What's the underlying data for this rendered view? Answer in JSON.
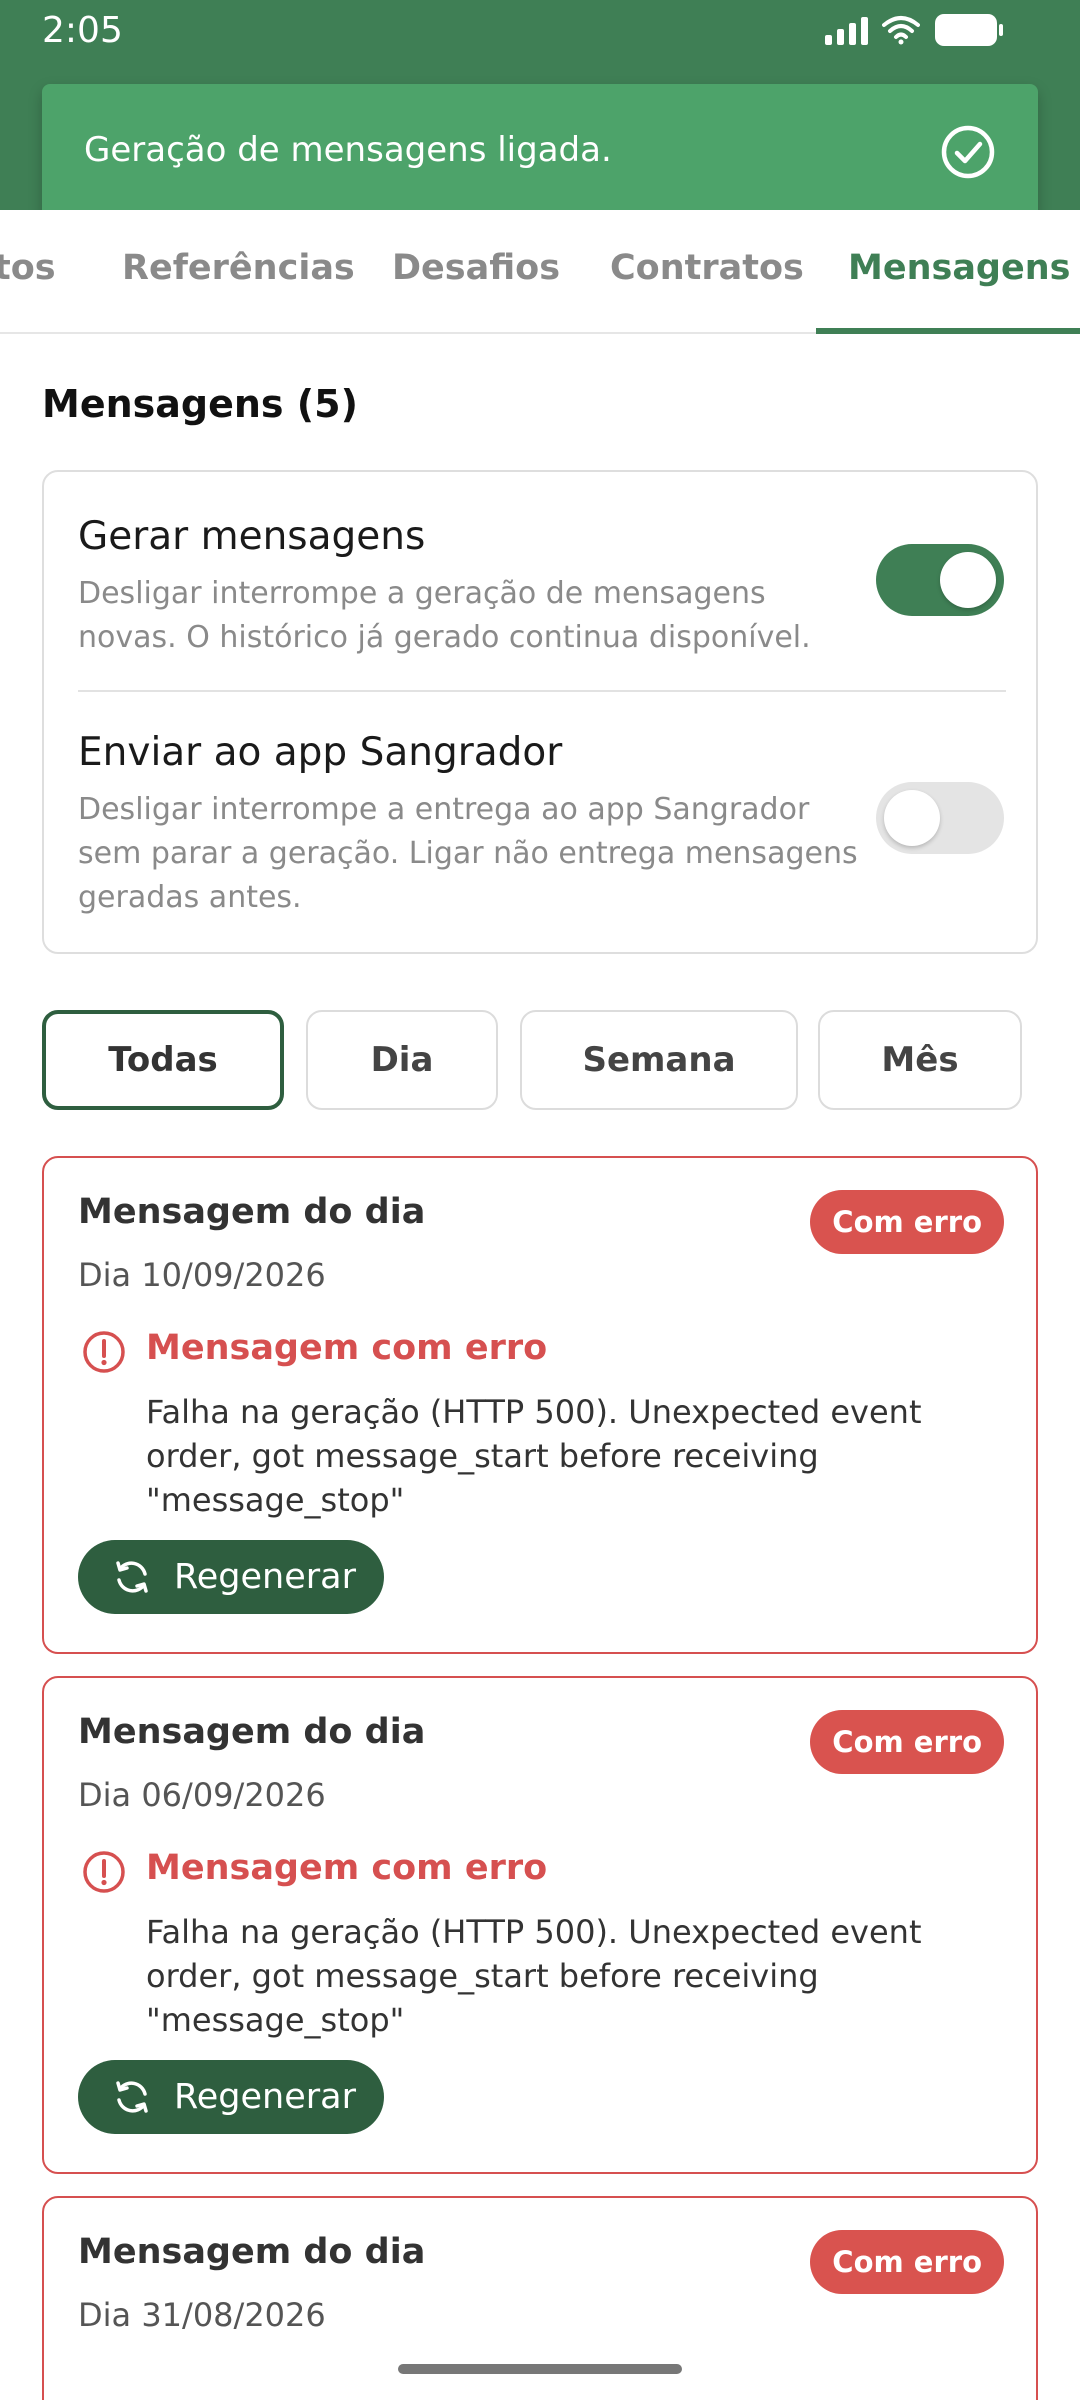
{
  "status_bar": {
    "time": "2:05"
  },
  "toast": {
    "text": "Geração de mensagens ligada."
  },
  "tabs": [
    {
      "label": "tos"
    },
    {
      "label": "Referências"
    },
    {
      "label": "Desafios"
    },
    {
      "label": "Contratos"
    },
    {
      "label": "Mensagens",
      "active": true
    }
  ],
  "section": {
    "title": "Mensagens (5)"
  },
  "settings": {
    "generate": {
      "title": "Gerar mensagens",
      "description": "Desligar interrompe a geração de mensagens novas. O histórico já gerado continua disponível.",
      "enabled": true
    },
    "send": {
      "title": "Enviar ao app Sangrador",
      "description": "Desligar interrompe a entrega ao app Sangrador sem parar a geração. Ligar não entrega mensagens geradas antes.",
      "enabled": false
    }
  },
  "filters": [
    {
      "label": "Todas",
      "active": true
    },
    {
      "label": "Dia"
    },
    {
      "label": "Semana"
    },
    {
      "label": "Mês"
    }
  ],
  "messages": [
    {
      "title": "Mensagem do dia",
      "date": "Dia 10/09/2026",
      "badge": "Com erro",
      "error_title": "Mensagem com erro",
      "error_text": "Falha na geração (HTTP 500). Unexpected event order, got message_start before receiving \"message_stop\"",
      "action": "Regenerar"
    },
    {
      "title": "Mensagem do dia",
      "date": "Dia 06/09/2026",
      "badge": "Com erro",
      "error_title": "Mensagem com erro",
      "error_text": "Falha na geração (HTTP 500). Unexpected event order, got message_start before receiving \"message_stop\"",
      "action": "Regenerar"
    },
    {
      "title": "Mensagem do dia",
      "date": "Dia 31/08/2026",
      "badge": "Com erro"
    }
  ],
  "colors": {
    "primary": "#3f7f55",
    "primary_dark": "#2e5e3f",
    "toast": "#4da36a",
    "error": "#d65050"
  }
}
